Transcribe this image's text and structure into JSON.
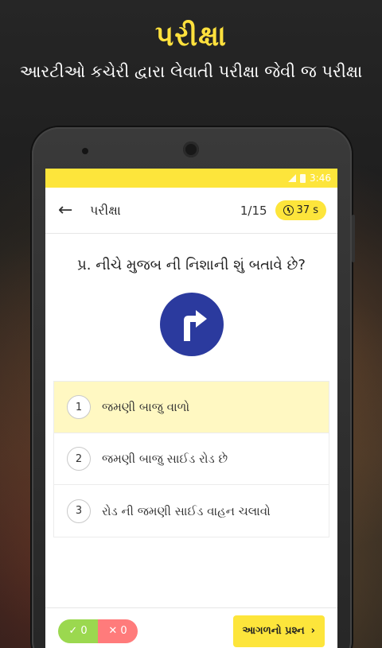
{
  "hero": {
    "title": "પરીક્ષા",
    "subtitle": "આરટીઓ કચેરી દ્વારા લેવાતી પરીક્ષા જેવી જ પરીક્ષા"
  },
  "status_bar": {
    "time": "3:46"
  },
  "app_bar": {
    "title": "પરીક્ષા",
    "counter": "1/15",
    "timer": "37 s"
  },
  "question": {
    "text": "પ્ર. નીચે મુજબ ની નિશાની શું બતાવે છે?",
    "sign_icon": "turn-right-arrow-icon"
  },
  "options": [
    {
      "num": "1",
      "text": "જમણી બાજુ વાળો",
      "selected": true
    },
    {
      "num": "2",
      "text": "જમણી બાજુ સાઈડ રોડ છે",
      "selected": false
    },
    {
      "num": "3",
      "text": "રોડ ની જમણી સાઈડ વાહન ચલાવો",
      "selected": false
    }
  ],
  "score": {
    "correct_icon": "✓",
    "correct": "0",
    "wrong_icon": "✕",
    "wrong": "0"
  },
  "next_button": {
    "label": "આગળનો પ્રશ્ન",
    "icon": "›"
  },
  "colors": {
    "accent": "#fde53b",
    "hero_title": "#ffe13d",
    "sign_blue": "#2b3a9e",
    "correct": "#9bd84f",
    "wrong": "#ff7b7b",
    "selected_bg": "#fff8c2"
  }
}
